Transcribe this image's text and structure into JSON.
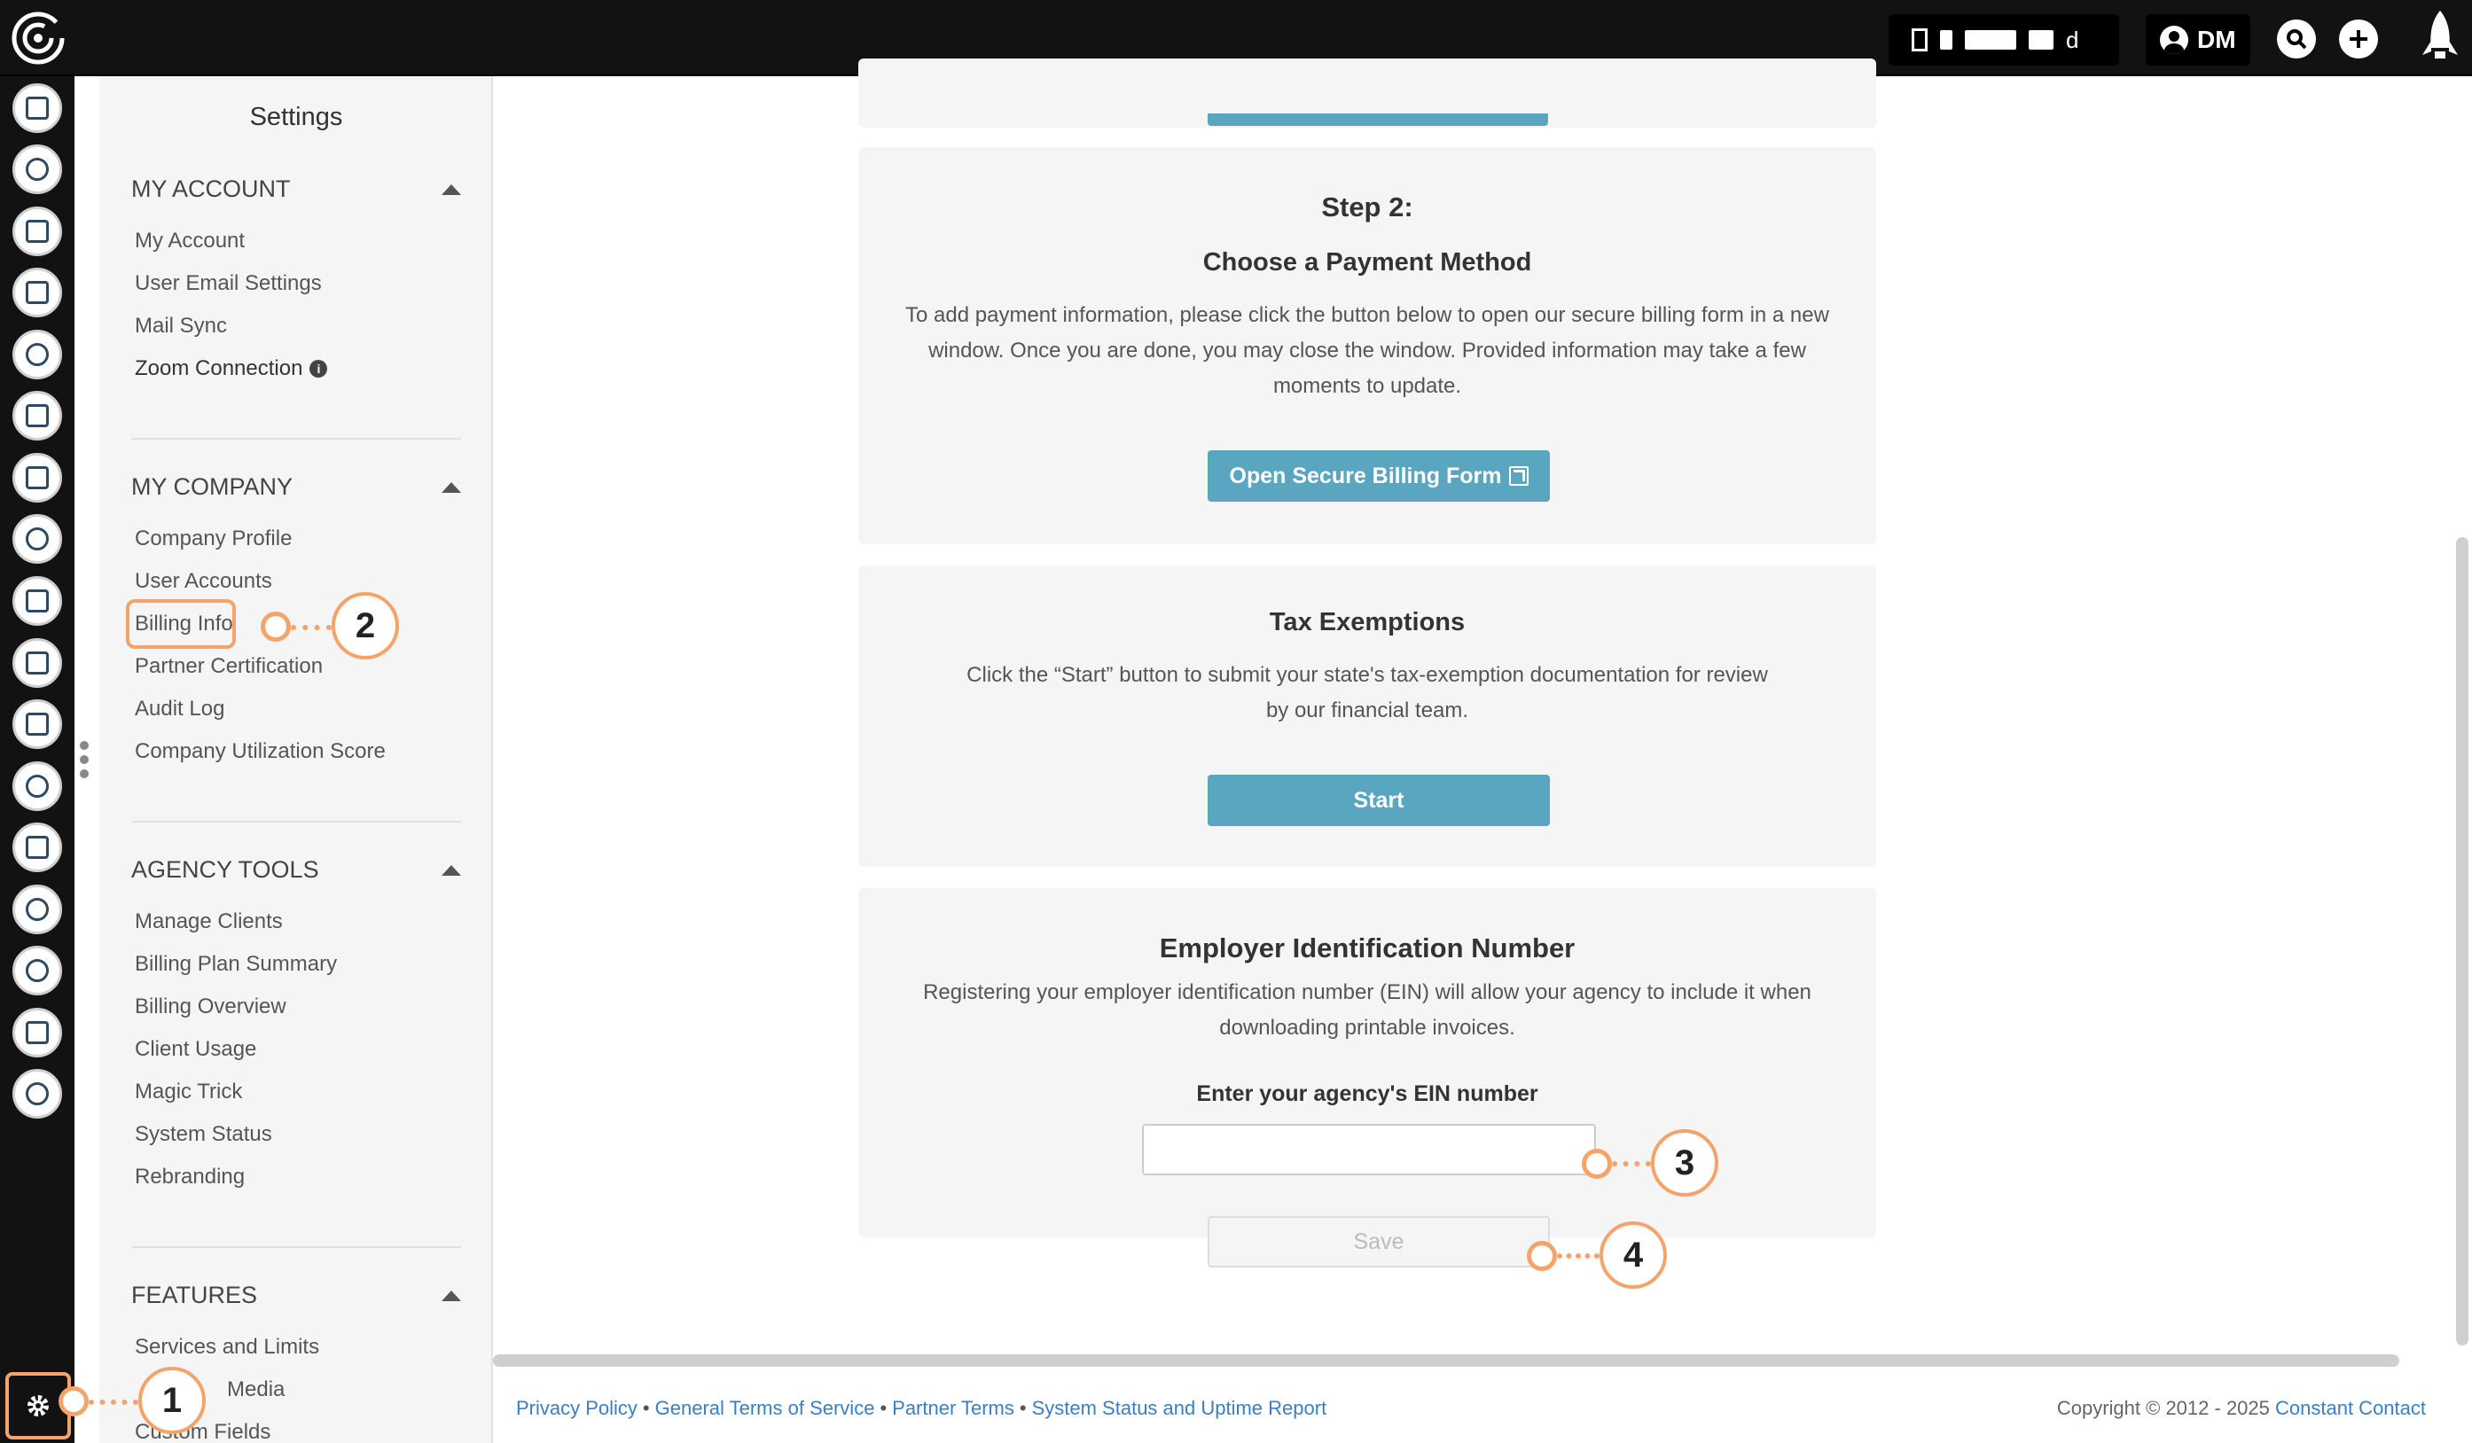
{
  "topbar": {
    "org_label": "d",
    "user_initials": "DM"
  },
  "rail": {
    "icons": [
      "contacts-icon",
      "email-icon",
      "clipboard-icon",
      "map-icon",
      "workflow-icon",
      "list-icon",
      "megaphone-icon",
      "chat-icon",
      "thumbs-up-icon",
      "image-icon",
      "calendar-icon",
      "handshake-icon",
      "analytics-icon",
      "support-icon",
      "user-star-icon",
      "reports-icon",
      "plug-icon"
    ]
  },
  "settings": {
    "title": "Settings",
    "sections": {
      "my_account": {
        "title": "MY ACCOUNT",
        "items": [
          "My Account",
          "User Email Settings",
          "Mail Sync",
          "Zoom Connection"
        ]
      },
      "my_company": {
        "title": "MY COMPANY",
        "items": [
          "Company Profile",
          "User Accounts",
          "Billing Info",
          "Partner Certification",
          "Audit Log",
          "Company Utilization Score"
        ]
      },
      "agency_tools": {
        "title": "AGENCY TOOLS",
        "items": [
          "Manage Clients",
          "Billing Plan Summary",
          "Billing Overview",
          "Client Usage",
          "Magic Trick",
          "System Status",
          "Rebranding"
        ]
      },
      "features": {
        "title": "FEATURES",
        "items": [
          "Services and Limits",
          "Media",
          "Custom Fields"
        ]
      }
    }
  },
  "main": {
    "step2": {
      "heading": "Step 2:",
      "subheading": "Choose a Payment Method",
      "description": "To add payment information, please click the button below to open our secure billing form in a new window. Once you are done, you may close the window. Provided information may take a few moments to update.",
      "button": "Open Secure Billing Form"
    },
    "tax": {
      "heading": "Tax Exemptions",
      "description": "Click the “Start” button to submit your state's tax-exemption documentation for review by our financial team.",
      "button": "Start"
    },
    "ein": {
      "heading": "Employer Identification Number",
      "description": "Registering your employer identification number (EIN) will allow your agency to include it when downloading printable invoices.",
      "label": "Enter your agency's EIN number",
      "value": "",
      "button": "Save"
    }
  },
  "footer": {
    "links": [
      "Privacy Policy",
      "General Terms of Service",
      "Partner Terms",
      "System Status and Uptime Report"
    ],
    "copyright": "Copyright © 2012 - 2025",
    "brand": "Constant Contact"
  },
  "callouts": [
    "1",
    "2",
    "3",
    "4"
  ],
  "colors": {
    "accent": "#5aa6c0",
    "callout": "#f4a46a",
    "link": "#3a7fc1",
    "topbar": "#121212"
  }
}
